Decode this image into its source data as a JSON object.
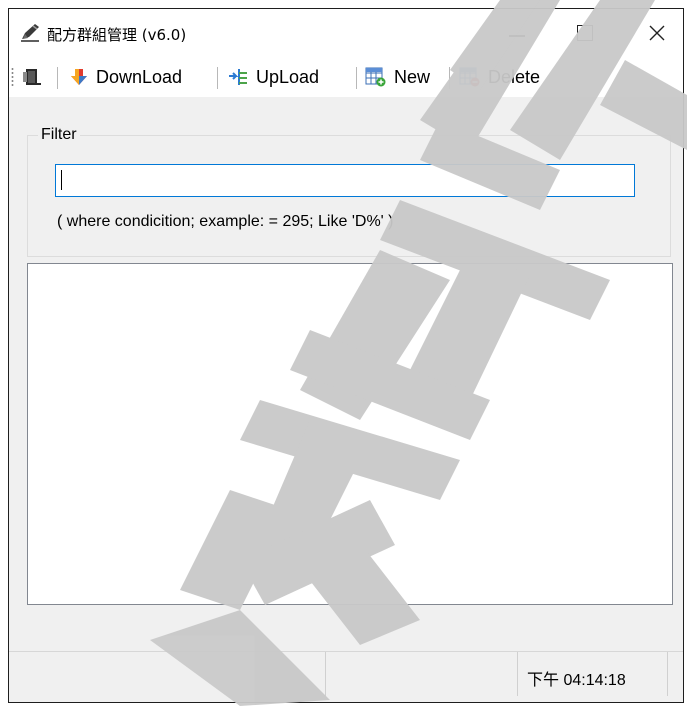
{
  "window": {
    "title": "配方群組管理 (v6.0)",
    "icon": "pen-icon"
  },
  "toolbar": {
    "exit_icon": "door-exit-icon",
    "download_label": "DownLoad",
    "upload_label": "UpLoad",
    "new_label": "New",
    "delete_label": "Delete"
  },
  "filter": {
    "legend": "Filter",
    "value": "",
    "hint": "( where condicition; example: = 295; Like 'D%' )"
  },
  "list": {
    "items": []
  },
  "status": {
    "time": "下午 04:14:18"
  },
  "colors": {
    "accent": "#0078d7",
    "watermark": "#c8c8c8"
  }
}
